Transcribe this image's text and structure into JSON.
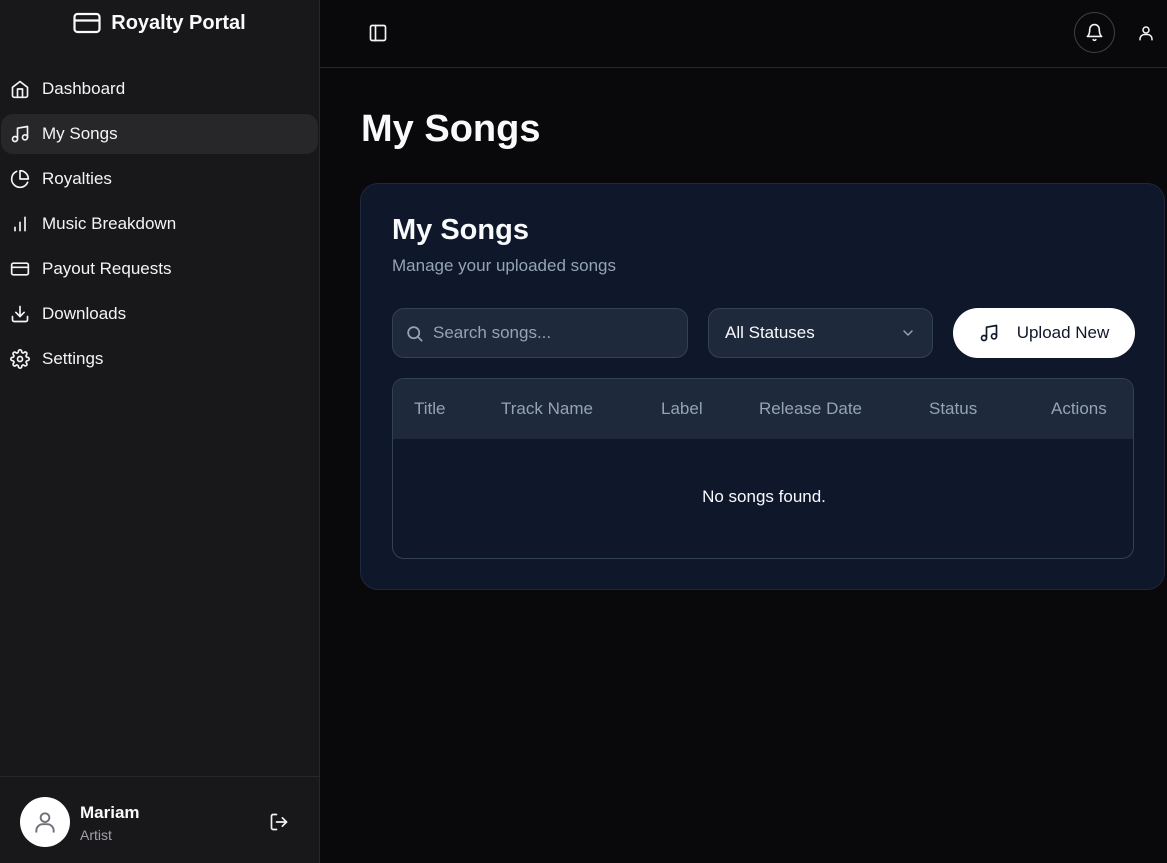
{
  "brand": {
    "title": "Royalty Portal",
    "icon": "credit-card-icon"
  },
  "sidebar": {
    "items": [
      {
        "label": "Dashboard",
        "icon": "home-icon",
        "active": false
      },
      {
        "label": "My Songs",
        "icon": "music-note-icon",
        "active": true
      },
      {
        "label": "Royalties",
        "icon": "pie-chart-icon",
        "active": false
      },
      {
        "label": "Music Breakdown",
        "icon": "bar-chart-icon",
        "active": false
      },
      {
        "label": "Payout Requests",
        "icon": "credit-card-icon",
        "active": false
      },
      {
        "label": "Downloads",
        "icon": "download-icon",
        "active": false
      },
      {
        "label": "Settings",
        "icon": "gear-icon",
        "active": false
      }
    ]
  },
  "user": {
    "name": "Mariam",
    "role": "Artist"
  },
  "page": {
    "title": "My Songs"
  },
  "card": {
    "title": "My Songs",
    "subtitle": "Manage your uploaded songs",
    "search_placeholder": "Search songs...",
    "status_filter": "All Statuses",
    "upload_label": "Upload New"
  },
  "table": {
    "columns": [
      "Title",
      "Track Name",
      "Label",
      "Release Date",
      "Status",
      "Actions"
    ],
    "empty_message": "No songs found."
  },
  "colors": {
    "background": "#09090b",
    "sidebar": "#18181b",
    "card": "#0f172a",
    "accent": "#ffffff"
  }
}
